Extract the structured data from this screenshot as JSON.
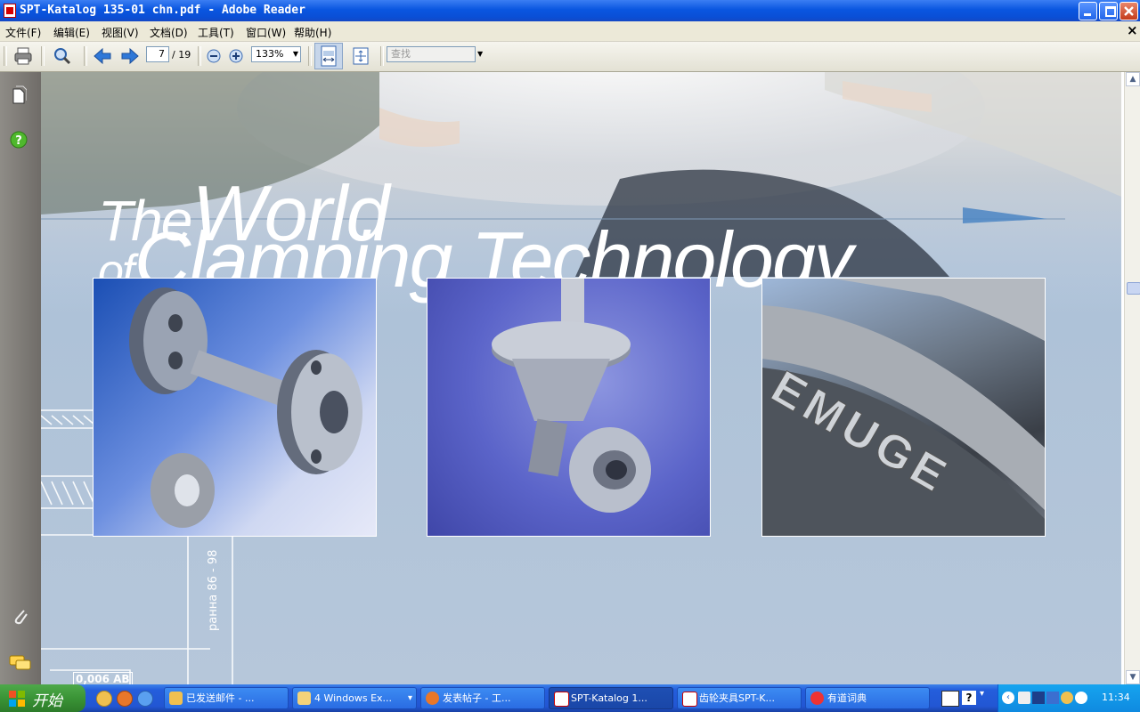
{
  "window": {
    "title": "SPT-Katalog 135-01 chn.pdf - Adobe Reader"
  },
  "menu": {
    "items": [
      "文件(F)",
      "编辑(E)",
      "视图(V)",
      "文档(D)",
      "工具(T)",
      "窗口(W)",
      "帮助(H)"
    ],
    "close_glyph": "×"
  },
  "toolbar": {
    "page_current": "7",
    "page_total": "/ 19",
    "zoom": "133%",
    "search_placeholder": "查找"
  },
  "document": {
    "headline_line1_a": "The",
    "headline_line1_b": "World",
    "headline_line2_a": "of",
    "headline_line2_b": "Clamping Technology",
    "engraving": "EMUGE",
    "drawing_text_1": "ранна 86 - 98",
    "drawing_text_2": "0,006 AB"
  },
  "taskbar": {
    "start_label": "开始",
    "tasks": [
      {
        "label": "已发送邮件 - ..."
      },
      {
        "label": "4 Windows Ex...",
        "dropdown": "▾"
      },
      {
        "label": "发表帖子 - 工..."
      },
      {
        "label": "SPT-Katalog 1..."
      },
      {
        "label": "齿轮夹具SPT-K..."
      },
      {
        "label": "有道词典"
      }
    ],
    "clock": "11:34"
  },
  "colors": {
    "title_bar": "#0a56e0",
    "taskbar": "#245edc",
    "start": "#3a9436",
    "doc_bg": "#b6c7da",
    "tray": "#0f8ae0"
  }
}
